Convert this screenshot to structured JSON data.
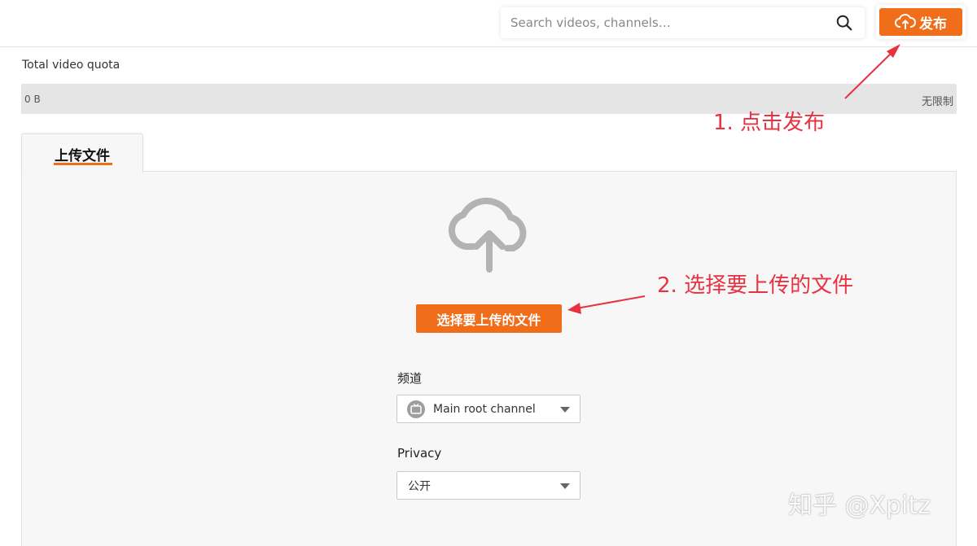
{
  "header": {
    "search_placeholder": "Search videos, channels…",
    "publish_label": "发布"
  },
  "quota": {
    "title": "Total video quota",
    "used": "0 B",
    "limit": "无限制",
    "used_fraction": 0
  },
  "tabs": [
    {
      "label": "上传文件",
      "active": true
    }
  ],
  "upload": {
    "choose_label": "选择要上传的文件",
    "channel_label": "频道",
    "channel_value": "Main root channel",
    "privacy_label": "Privacy",
    "privacy_value": "公开"
  },
  "annotations": {
    "step1": "1. 点击发布",
    "step2": "2. 选择要上传的文件"
  },
  "watermark": "知乎 @Xpitz",
  "colors": {
    "accent": "#f06d1a",
    "annotation": "#e8323f",
    "quota_bar": "#e5e5e5",
    "panel": "#f7f7f7"
  }
}
